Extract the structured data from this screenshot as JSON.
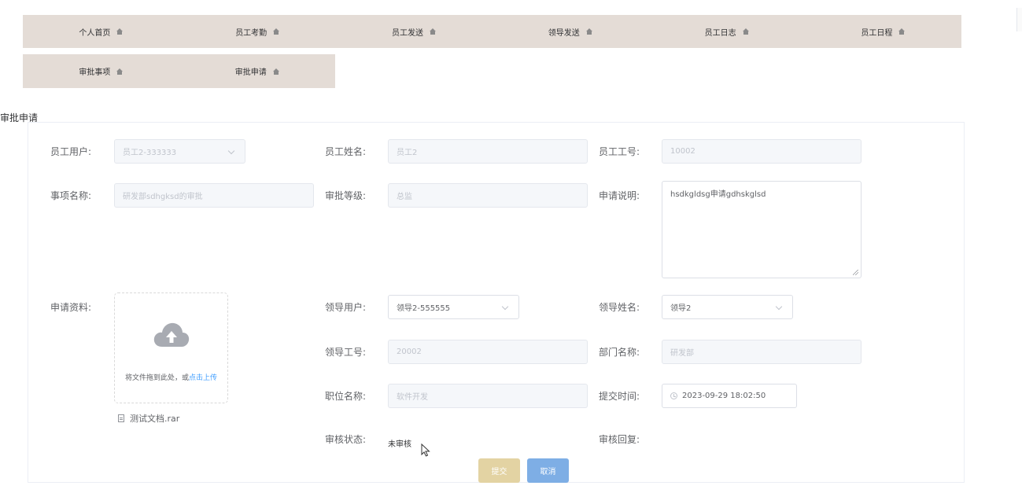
{
  "nav": {
    "row1": [
      {
        "label": "个人首页"
      },
      {
        "label": "员工考勤"
      },
      {
        "label": "员工发送"
      },
      {
        "label": "领导发送"
      },
      {
        "label": "员工日志"
      },
      {
        "label": "员工日程"
      }
    ],
    "row2": [
      {
        "label": "审批事项"
      },
      {
        "label": "审批申请"
      }
    ]
  },
  "section_title": "审批申请",
  "form": {
    "employee_user": {
      "label": "员工用户:",
      "value": "员工2-333333"
    },
    "employee_name": {
      "label": "员工姓名:",
      "value": "员工2"
    },
    "employee_no": {
      "label": "员工工号:",
      "value": "10002"
    },
    "item_name": {
      "label": "事项名称:",
      "value": "研发部sdhgksd的审批"
    },
    "approval_level": {
      "label": "审批等级:",
      "value": "总监"
    },
    "application_desc": {
      "label": "申请说明:",
      "value": "hsdkgldsg申请gdhskglsd"
    },
    "materials": {
      "label": "申请资料:",
      "upload_text": "将文件拖到此处，或",
      "upload_link": "点击上传",
      "file_name": "测试文档.rar"
    },
    "leader_user": {
      "label": "领导用户:",
      "value": "领导2-555555"
    },
    "leader_name": {
      "label": "领导姓名:",
      "value": "领导2"
    },
    "leader_no": {
      "label": "领导工号:",
      "value": "20002"
    },
    "dept_name": {
      "label": "部门名称:",
      "value": "研发部"
    },
    "position_name": {
      "label": "职位名称:",
      "value": "软件开发"
    },
    "submit_time": {
      "label": "提交时间:",
      "value": "2023-09-29 18:02:50"
    },
    "review_status": {
      "label": "审核状态:",
      "value": "未审核"
    },
    "review_reply": {
      "label": "审核回复:"
    }
  },
  "buttons": {
    "submit": "提交",
    "cancel": "取消"
  },
  "colors": {
    "nav_bg": "#e4dcd6",
    "submit_bg": "#e3d3a3",
    "cancel_bg": "#7eaee5",
    "link": "#409eff"
  }
}
